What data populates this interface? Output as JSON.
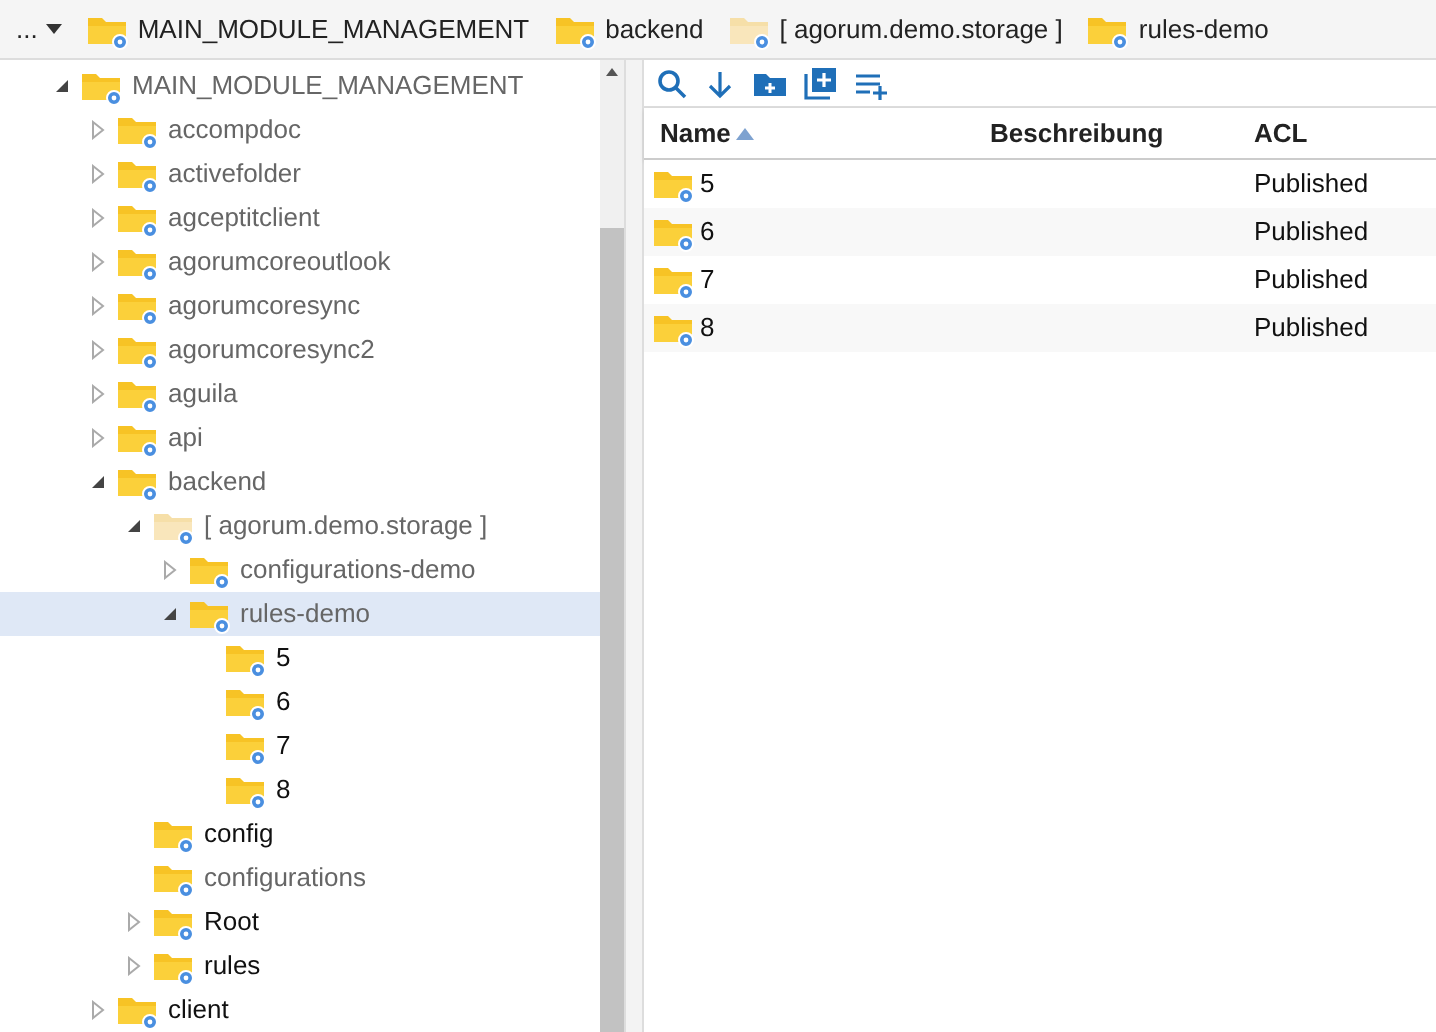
{
  "breadcrumb": {
    "menu_label": "...",
    "items": [
      {
        "label": "MAIN_MODULE_MANAGEMENT",
        "faded": false
      },
      {
        "label": "backend",
        "faded": false
      },
      {
        "label": "[ agorum.demo.storage ]",
        "faded": true
      },
      {
        "label": "rules-demo",
        "faded": false
      }
    ]
  },
  "tree": [
    {
      "label": "MAIN_MODULE_MANAGEMENT",
      "kind": "branch",
      "expanded": true,
      "dimmed": true,
      "faded": false,
      "selected": false,
      "children": [
        {
          "label": "accompdoc",
          "kind": "branch",
          "expanded": false,
          "dimmed": true,
          "faded": false,
          "selected": false
        },
        {
          "label": "activefolder",
          "kind": "branch",
          "expanded": false,
          "dimmed": true,
          "faded": false,
          "selected": false
        },
        {
          "label": "agceptitclient",
          "kind": "branch",
          "expanded": false,
          "dimmed": true,
          "faded": false,
          "selected": false
        },
        {
          "label": "agorumcoreoutlook",
          "kind": "branch",
          "expanded": false,
          "dimmed": true,
          "faded": false,
          "selected": false
        },
        {
          "label": "agorumcoresync",
          "kind": "branch",
          "expanded": false,
          "dimmed": true,
          "faded": false,
          "selected": false
        },
        {
          "label": "agorumcoresync2",
          "kind": "branch",
          "expanded": false,
          "dimmed": true,
          "faded": false,
          "selected": false
        },
        {
          "label": "aguila",
          "kind": "branch",
          "expanded": false,
          "dimmed": true,
          "faded": false,
          "selected": false
        },
        {
          "label": "api",
          "kind": "branch",
          "expanded": false,
          "dimmed": true,
          "faded": false,
          "selected": false
        },
        {
          "label": "backend",
          "kind": "branch",
          "expanded": true,
          "dimmed": true,
          "faded": false,
          "selected": false,
          "children": [
            {
              "label": "[ agorum.demo.storage ]",
              "kind": "branch",
              "expanded": true,
              "dimmed": true,
              "faded": true,
              "selected": false,
              "children": [
                {
                  "label": "configurations-demo",
                  "kind": "branch",
                  "expanded": false,
                  "dimmed": true,
                  "faded": false,
                  "selected": false
                },
                {
                  "label": "rules-demo",
                  "kind": "branch",
                  "expanded": true,
                  "dimmed": true,
                  "faded": false,
                  "selected": true,
                  "children": [
                    {
                      "label": "5",
                      "kind": "leaf",
                      "expanded": false,
                      "dimmed": false,
                      "faded": false,
                      "selected": false
                    },
                    {
                      "label": "6",
                      "kind": "leaf",
                      "expanded": false,
                      "dimmed": false,
                      "faded": false,
                      "selected": false
                    },
                    {
                      "label": "7",
                      "kind": "leaf",
                      "expanded": false,
                      "dimmed": false,
                      "faded": false,
                      "selected": false
                    },
                    {
                      "label": "8",
                      "kind": "leaf",
                      "expanded": false,
                      "dimmed": false,
                      "faded": false,
                      "selected": false
                    }
                  ]
                }
              ]
            },
            {
              "label": "config",
              "kind": "leaf",
              "expanded": false,
              "dimmed": false,
              "faded": false,
              "selected": false
            },
            {
              "label": "configurations",
              "kind": "leaf",
              "expanded": false,
              "dimmed": true,
              "faded": false,
              "selected": false
            },
            {
              "label": "Root",
              "kind": "branch",
              "expanded": false,
              "dimmed": false,
              "faded": false,
              "selected": false
            },
            {
              "label": "rules",
              "kind": "branch",
              "expanded": false,
              "dimmed": false,
              "faded": false,
              "selected": false
            }
          ]
        },
        {
          "label": "client",
          "kind": "branch",
          "expanded": false,
          "dimmed": false,
          "faded": false,
          "selected": false
        }
      ]
    }
  ],
  "table": {
    "columns": [
      {
        "label": "Name",
        "sorted": true
      },
      {
        "label": "Beschreibung",
        "sorted": false
      },
      {
        "label": "ACL",
        "sorted": false
      }
    ],
    "rows": [
      {
        "name": "5",
        "acl": "Published"
      },
      {
        "name": "6",
        "acl": "Published"
      },
      {
        "name": "7",
        "acl": "Published"
      },
      {
        "name": "8",
        "acl": "Published"
      }
    ]
  }
}
